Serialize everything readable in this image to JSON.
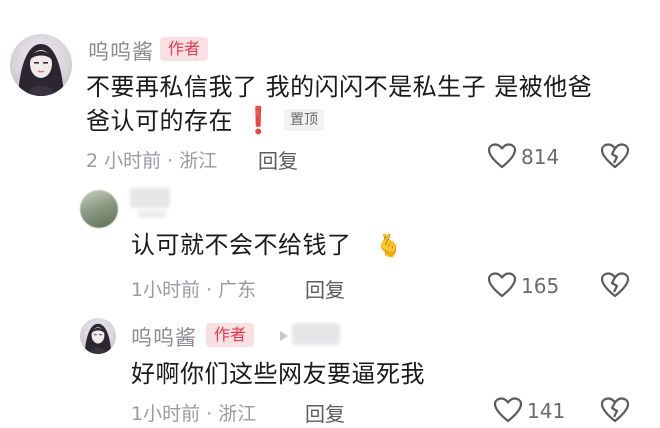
{
  "comments": [
    {
      "username": "呜呜酱",
      "author_badge": "作者",
      "text_line1": "不要再私信我了 我的闪闪不是私生子 是被他爸",
      "text_line2": "爸认可的存在",
      "exclaim": "❗",
      "pin_label": "置顶",
      "time": "2 小时前 · 浙江",
      "reply_label": "回复",
      "like_count": "814"
    },
    {
      "username": "",
      "text": "认可就不会不给钱了",
      "emoji": "🫰",
      "time": "1小时前 · 广东",
      "reply_label": "回复",
      "like_count": "165"
    },
    {
      "username": "呜呜酱",
      "author_badge": "作者",
      "text": "好啊你们这些网友要逼死我",
      "time": "1小时前 · 浙江",
      "reply_label": "回复",
      "like_count": "141"
    }
  ],
  "icons": {
    "like": "heart-outline-icon",
    "dislike": "broken-heart-icon",
    "reply_arrow": "triangle-right-icon"
  },
  "colors": {
    "author_badge_bg": "#f9e1e3",
    "author_badge_text": "#e8384f",
    "meta_text": "#9a9aa0"
  }
}
